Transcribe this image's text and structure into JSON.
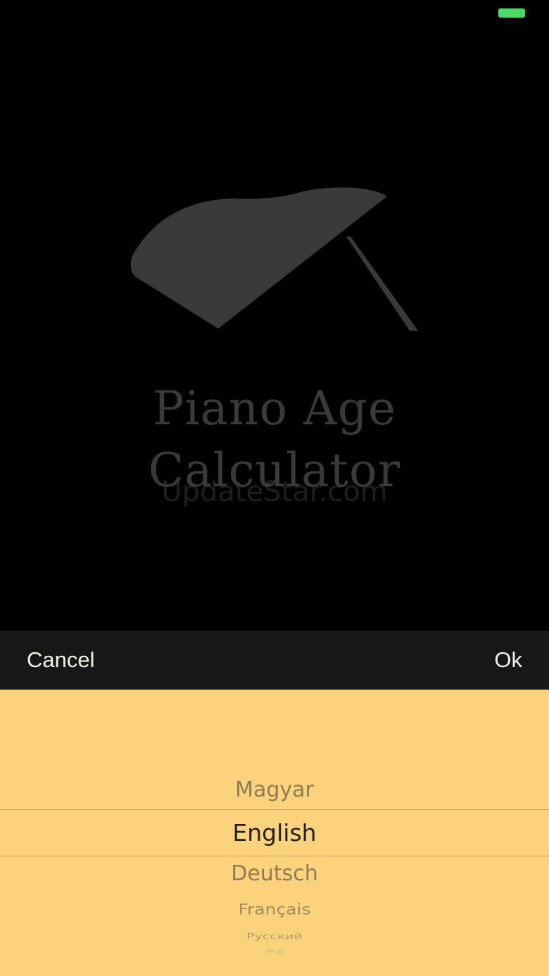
{
  "status_bar": {
    "battery_color": "#4cd964"
  },
  "splash": {
    "title_line1": "Piano Age",
    "title_line2": "Calculator",
    "watermark": "UpdateStar.com",
    "title_color": "#3a3a3a",
    "piano_color": "#3a3a3a",
    "logo_icon": "grand-piano-icon"
  },
  "toolbar": {
    "cancel_label": "Cancel",
    "ok_label": "Ok"
  },
  "picker": {
    "background": "#fcd37c",
    "selected": "English",
    "options": [
      "Magyar",
      "English",
      "Deutsch",
      "Français",
      "Русский",
      "中文"
    ]
  }
}
